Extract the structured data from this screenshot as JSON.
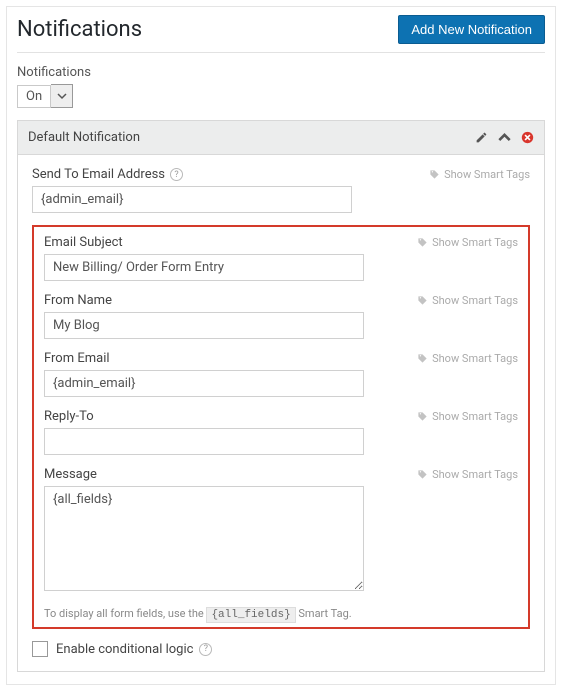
{
  "page": {
    "title": "Notifications",
    "addButton": "Add New Notification"
  },
  "toggle": {
    "label": "Notifications",
    "value": "On"
  },
  "panel": {
    "title": "Default Notification"
  },
  "smartTagsLabel": "Show Smart Tags",
  "fields": {
    "sendTo": {
      "label": "Send To Email Address",
      "value": "{admin_email}"
    },
    "subject": {
      "label": "Email Subject",
      "value": "New Billing/ Order Form Entry"
    },
    "fromName": {
      "label": "From Name",
      "value": "My Blog"
    },
    "fromEmail": {
      "label": "From Email",
      "value": "{admin_email}"
    },
    "replyTo": {
      "label": "Reply-To",
      "value": ""
    },
    "message": {
      "label": "Message",
      "value": "{all_fields}"
    }
  },
  "hint": {
    "pre": "To display all form fields, use the ",
    "code": "{all_fields}",
    "post": " Smart Tag."
  },
  "conditional": {
    "label": "Enable conditional logic"
  }
}
